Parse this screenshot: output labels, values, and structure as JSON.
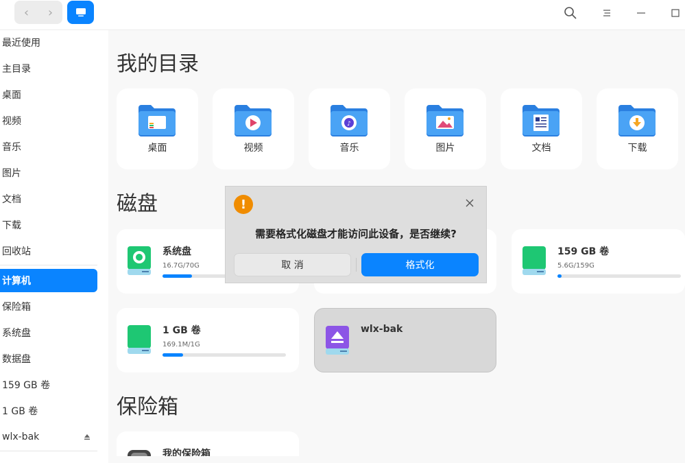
{
  "titlebar": {
    "back_glyph": "‹",
    "forward_glyph": "›",
    "icons": [
      "search-icon",
      "menu-icon",
      "minimize-icon",
      "maximize-icon"
    ]
  },
  "sidebar": {
    "items": [
      {
        "label": "最近使用"
      },
      {
        "label": "主目录"
      },
      {
        "label": "桌面"
      },
      {
        "label": "视频"
      },
      {
        "label": "音乐"
      },
      {
        "label": "图片"
      },
      {
        "label": "文档"
      },
      {
        "label": "下载"
      },
      {
        "label": "回收站"
      },
      {
        "label": "计算机"
      },
      {
        "label": "保险箱"
      },
      {
        "label": "系统盘"
      },
      {
        "label": "数据盘"
      },
      {
        "label": "159 GB 卷"
      },
      {
        "label": "1 GB 卷"
      },
      {
        "label": "wlx-bak"
      }
    ],
    "active_label": "计算机"
  },
  "main": {
    "dir_title": "我的目录",
    "folders": [
      {
        "label": "桌面",
        "icon": "desktop-folder-icon"
      },
      {
        "label": "视频",
        "icon": "video-folder-icon"
      },
      {
        "label": "音乐",
        "icon": "music-folder-icon"
      },
      {
        "label": "图片",
        "icon": "picture-folder-icon"
      },
      {
        "label": "文档",
        "icon": "document-folder-icon"
      },
      {
        "label": "下载",
        "icon": "download-folder-icon"
      }
    ],
    "disk_title": "磁盘",
    "disks": [
      {
        "name": "系统盘",
        "usage": "16.7G/70G",
        "used_fraction": 0.24
      },
      {
        "name": "159 GB 卷",
        "usage": "5.6G/159G",
        "used_fraction": 0.035
      },
      {
        "name": "1 GB 卷",
        "usage": "169.1M/1G",
        "used_fraction": 0.165
      },
      {
        "name": "wlx-bak",
        "usage": ""
      }
    ],
    "vault_title": "保险箱",
    "vault": {
      "name": "我的保险箱"
    }
  },
  "dialog": {
    "message": "需要格式化磁盘才能访问此设备，是否继续?",
    "cancel_label": "取 消",
    "format_label": "格式化",
    "warn_glyph": "!"
  },
  "colors": {
    "accent": "#0a84ff",
    "disk_green": "#1ec773",
    "disk_purple": "#8c55e6",
    "warning": "#f08c00"
  }
}
